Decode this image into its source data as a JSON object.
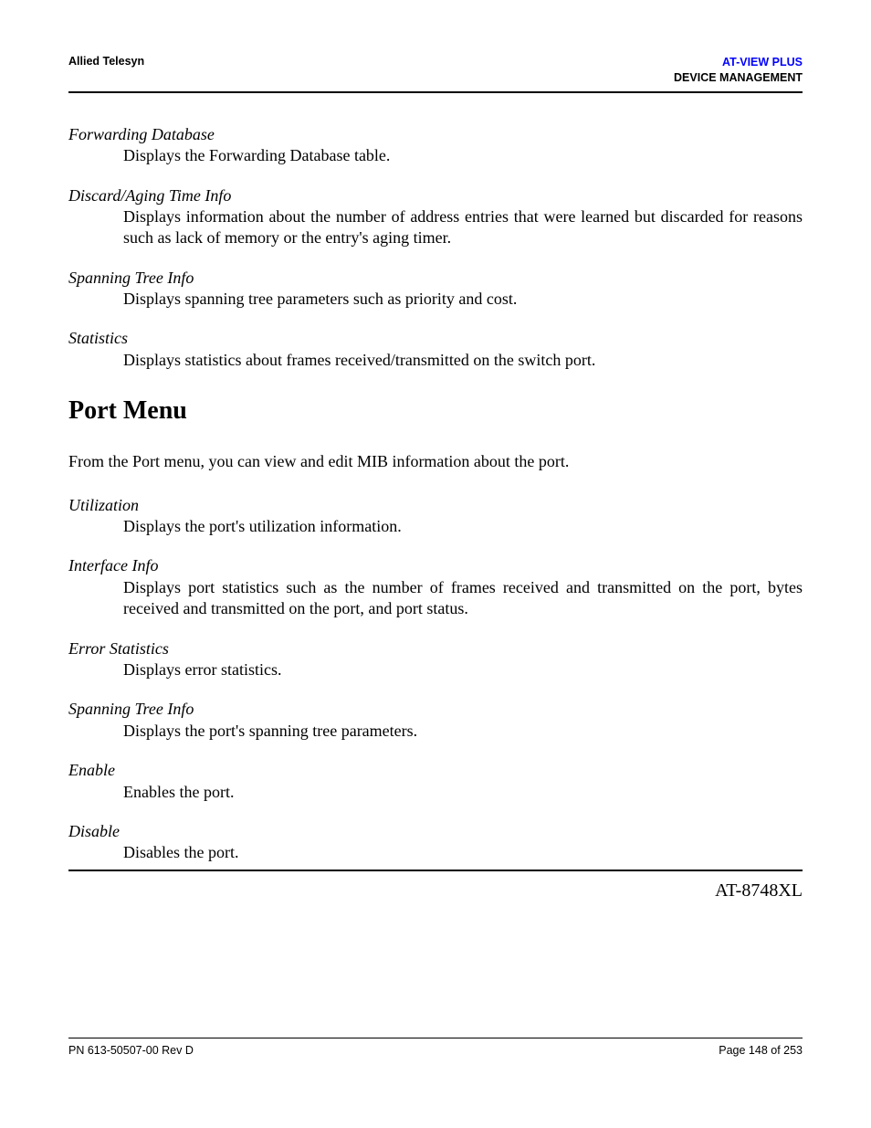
{
  "header": {
    "left": "Allied Telesyn",
    "right_title": "AT-VIEW PLUS",
    "right_sub": "DEVICE MANAGEMENT"
  },
  "defs_top": [
    {
      "term": "Forwarding Database",
      "desc": "Displays the Forwarding Database table."
    },
    {
      "term": "Discard/Aging Time Info",
      "desc": "Displays information about the number of address entries that were learned but discarded for reasons such as lack of memory or the entry's aging timer."
    },
    {
      "term": "Spanning Tree Info",
      "desc": "Displays spanning tree parameters such as priority and cost."
    },
    {
      "term": "Statistics",
      "desc": "Displays statistics about frames received/transmitted on the switch port."
    }
  ],
  "section": {
    "heading": "Port Menu",
    "intro": "From the Port menu, you can view and edit MIB information about the port."
  },
  "defs_port": [
    {
      "term": "Utilization",
      "desc": "Displays the port's utilization information."
    },
    {
      "term": "Interface Info",
      "desc": "Displays port statistics such as the number of frames received and transmitted on the port, bytes received and transmitted on the port, and port status."
    },
    {
      "term": "Error Statistics",
      "desc": "Displays error statistics."
    },
    {
      "term": "Spanning Tree Info",
      "desc": "Displays the port's spanning tree parameters."
    },
    {
      "term": "Enable",
      "desc": "Enables the port."
    },
    {
      "term": "Disable",
      "desc": "Disables the port."
    }
  ],
  "trailing_model": "AT-8748XL",
  "footer": {
    "left": "PN 613-50507-00 Rev D",
    "right": "Page 148 of 253"
  }
}
